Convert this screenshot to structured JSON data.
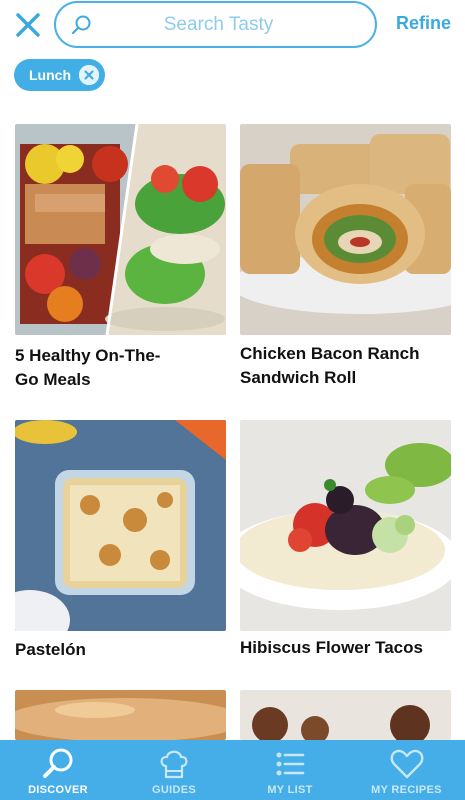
{
  "search": {
    "placeholder": "Search Tasty",
    "value": ""
  },
  "header": {
    "refine_label": "Refine"
  },
  "filters": [
    {
      "label": "Lunch"
    }
  ],
  "recipes": [
    {
      "title_line1": "5 Healthy On-The-",
      "title_line2": "Go Meals"
    },
    {
      "title_line1": "Chicken Bacon Ranch",
      "title_line2": "Sandwich Roll"
    },
    {
      "title_line1": "Pastelón",
      "title_line2": ""
    },
    {
      "title_line1": "Hibiscus Flower Tacos",
      "title_line2": ""
    }
  ],
  "tabs": [
    {
      "label": "DISCOVER",
      "icon": "search-icon",
      "active": true
    },
    {
      "label": "GUIDES",
      "icon": "chef-hat-icon",
      "active": false
    },
    {
      "label": "MY LIST",
      "icon": "list-icon",
      "active": false
    },
    {
      "label": "MY RECIPES",
      "icon": "heart-icon",
      "active": false
    }
  ],
  "colors": {
    "accent": "#45aee8",
    "chip": "#42aee6",
    "tab_inactive": "#c8e7f8"
  }
}
